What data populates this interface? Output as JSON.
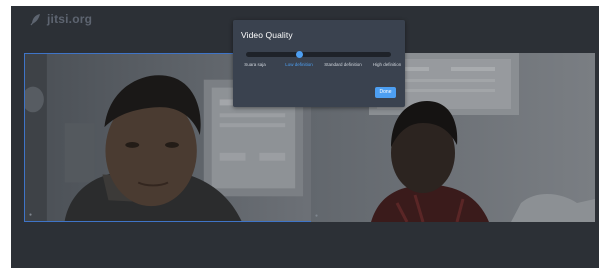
{
  "app": {
    "logo_text": "jitsi.org"
  },
  "dialog": {
    "title": "Video Quality",
    "slider": {
      "selected_index": 1,
      "options": [
        {
          "label": "Suara saja"
        },
        {
          "label": "Low definition"
        },
        {
          "label": "Standard definition"
        },
        {
          "label": "High definition"
        }
      ]
    },
    "done_label": "Done"
  },
  "colors": {
    "accent": "#4d9ff2",
    "background": "#2c3036",
    "dialog": "#3a424f",
    "active_tile_border": "#3f74c7"
  }
}
